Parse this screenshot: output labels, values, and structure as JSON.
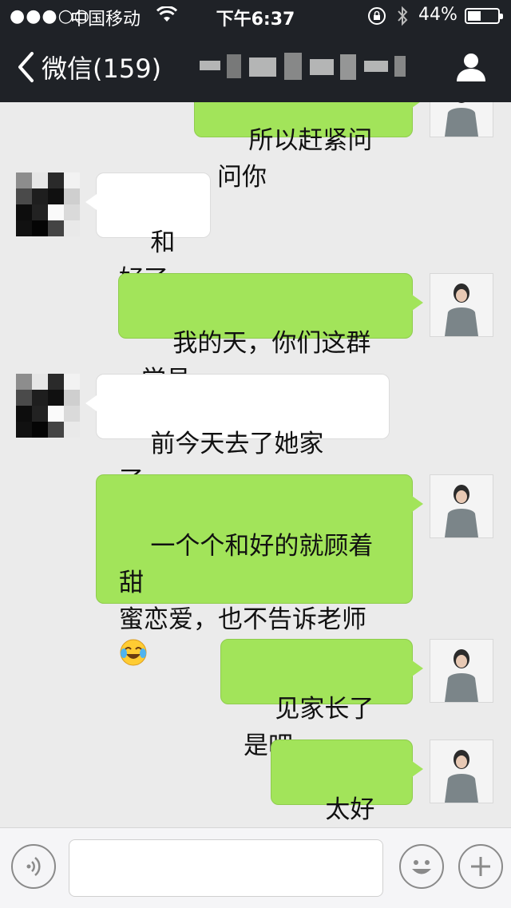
{
  "status_bar": {
    "signal": "●●●○○",
    "carrier": "中国移动",
    "time": "下午6:37",
    "battery_percent": "44%",
    "battery_level": 0.44
  },
  "nav": {
    "back_label": "微信(159)",
    "icons": {
      "back": "chevron-left-icon",
      "profile": "person-icon"
    }
  },
  "messages": [
    {
      "side": "out",
      "text": "所以赶紧问问你"
    },
    {
      "side": "in",
      "text": "和好了"
    },
    {
      "side": "out",
      "text": "我的天，你们这群学员"
    },
    {
      "side": "in",
      "text": "前今天去了她家了。。"
    },
    {
      "side": "out",
      "text": "一个个和好的就顾着甜\n蜜恋爱，也不告诉老师",
      "emoji": "😂"
    },
    {
      "side": "out",
      "text": "见家长了是吧"
    },
    {
      "side": "out",
      "text": "太好了！"
    }
  ],
  "input_bar": {
    "value": "",
    "icons": {
      "voice": "voice-icon",
      "emoji": "emoji-icon",
      "more": "plus-icon"
    }
  },
  "colors": {
    "header_bg": "#1f2227",
    "chat_bg": "#ebebeb",
    "outgoing_bubble": "#a2e45a",
    "incoming_bubble": "#ffffff"
  }
}
